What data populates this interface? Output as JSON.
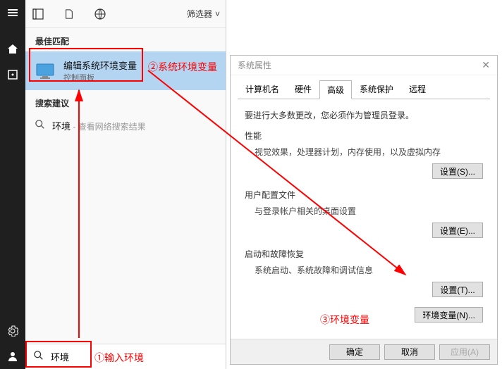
{
  "taskbar": {
    "items": [
      "menu-icon",
      "home-icon",
      "clock-icon"
    ],
    "bottom": [
      "settings-icon",
      "user-icon"
    ]
  },
  "search_panel": {
    "filter_label": "筛选器",
    "best_match_label": "最佳匹配",
    "result": {
      "title": "编辑系统环境变量",
      "subtitle": "控制面板"
    },
    "suggestions_label": "搜索建议",
    "suggestion": {
      "query": "环境",
      "desc": " - 查看网络搜索结果"
    },
    "search_value": "环境"
  },
  "dialog": {
    "title": "系统属性",
    "tabs": [
      "计算机名",
      "硬件",
      "高级",
      "系统保护",
      "远程"
    ],
    "active_tab": 2,
    "info": "要进行大多数更改，您必须作为管理员登录。",
    "perf": {
      "label": "性能",
      "desc": "视觉效果，处理器计划，内存使用，以及虚拟内存",
      "button": "设置(S)..."
    },
    "profile": {
      "label": "用户配置文件",
      "desc": "与登录帐户相关的桌面设置",
      "button": "设置(E)..."
    },
    "startup": {
      "label": "启动和故障恢复",
      "desc": "系统启动、系统故障和调试信息",
      "button": "设置(T)..."
    },
    "env_button": "环境变量(N)...",
    "footer": {
      "ok": "确定",
      "cancel": "取消",
      "apply": "应用(A)"
    }
  },
  "annotations": {
    "a1": "①输入环境",
    "a2": "②系统环境变量",
    "a3": "③环境变量"
  }
}
